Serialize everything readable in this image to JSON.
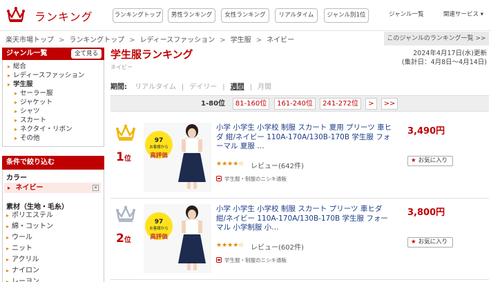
{
  "header": {
    "logo_text": "ランキング",
    "nav_pills": [
      "ランキングトップ",
      "男性ランキング",
      "女性ランキング",
      "リアルタイム",
      "ジャンル別1位"
    ],
    "nav_plain": [
      "ジャンル一覧",
      "関連サービス ▾"
    ]
  },
  "breadcrumb": {
    "items": [
      "楽天市場トップ",
      "ランキングトップ",
      "レディースファッション",
      "学生服",
      "ネイビー"
    ],
    "separator": ">",
    "genre_link": "このジャンルのランキング一覧 >>"
  },
  "sidebar": {
    "genre_heading": "ジャンル一覧",
    "show_all": "全て見る",
    "genres": [
      {
        "label": "総合",
        "bold": false,
        "sub": false
      },
      {
        "label": "レディースファッション",
        "bold": false,
        "sub": false
      },
      {
        "label": "学生服",
        "bold": true,
        "sub": false
      },
      {
        "label": "セーラー服",
        "bold": false,
        "sub": true
      },
      {
        "label": "ジャケット",
        "bold": false,
        "sub": true
      },
      {
        "label": "シャツ",
        "bold": false,
        "sub": true
      },
      {
        "label": "スカート",
        "bold": false,
        "sub": true
      },
      {
        "label": "ネクタイ・リボン",
        "bold": false,
        "sub": true
      },
      {
        "label": "その他",
        "bold": false,
        "sub": true
      }
    ],
    "filter_heading": "条件で絞り込む",
    "color_heading": "カラー",
    "color_selected": "ネイビー",
    "material_heading": "素材（生地・毛糸）",
    "materials": [
      "ポリエステル",
      "綿・コットン",
      "ウール",
      "ニット",
      "アクリル",
      "ナイロン",
      "レーヨン"
    ]
  },
  "main": {
    "title": "学生服ランキング",
    "subtitle": "ネイビー",
    "date_line1": "2024年4月17日(水)更新",
    "date_line2": "(集計日：4月8日～4月14日)",
    "period_label": "期間:",
    "periods": [
      {
        "label": "リアルタイム",
        "active": false
      },
      {
        "label": "デイリー",
        "active": false
      },
      {
        "label": "週間",
        "active": true
      },
      {
        "label": "月間",
        "active": false
      }
    ],
    "pagination": {
      "current": "1-80位",
      "pages": [
        "81-160位",
        "161-240位",
        "241-272位",
        ">",
        ">>"
      ]
    },
    "fav_label": "お気に入り",
    "items": [
      {
        "rank": "1",
        "rank_suffix": "位",
        "crown_color": "#f0b400",
        "title": "小学 小学生 小学校 制服 スカート 夏用 プリーツ 車ヒダ 紺/ネイビー 110A-170A/130B-170B 学生服 フォーマル 夏服 …",
        "price": "3,490円",
        "stars": "★★★★☆",
        "review": "レビュー(642件)",
        "shop": "学生服・制服のニシキ通販",
        "badge_line1": "97",
        "badge_line2": "お客様から",
        "badge_line3": "高評価"
      },
      {
        "rank": "2",
        "rank_suffix": "位",
        "crown_color": "#a9b3c1",
        "title": "小学 小学生 小学校 制服 スカート プリーツ 車ヒダ 紺/ネイビー 110A-170A/130B-170B 学生服 フォーマル 小学制服 小…",
        "price": "3,800円",
        "stars": "★★★★☆",
        "review": "レビュー(602件)",
        "shop": "学生服・制服のニシキ通販",
        "badge_line1": "97",
        "badge_line2": "お客様から",
        "badge_line3": "高評価"
      }
    ]
  }
}
